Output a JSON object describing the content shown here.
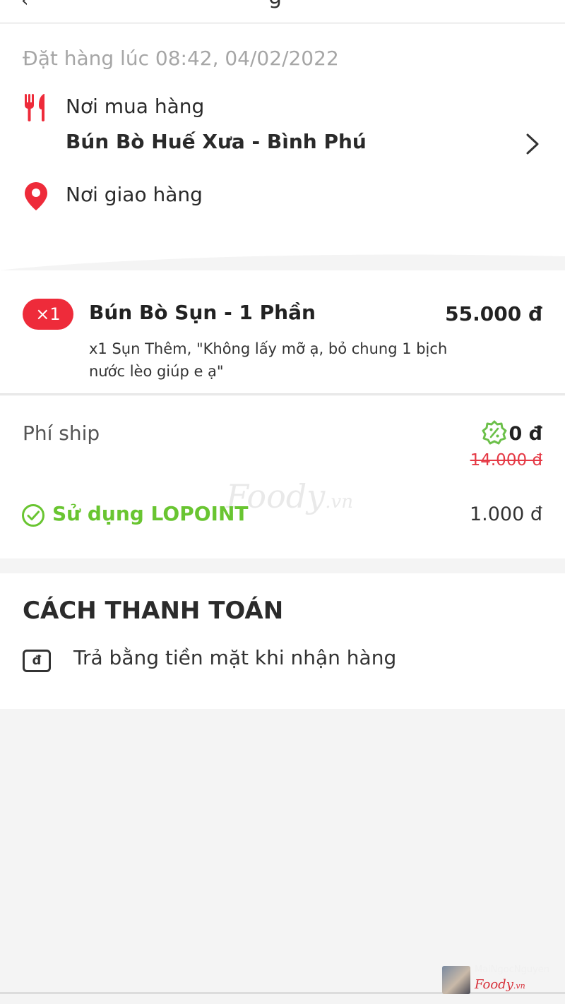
{
  "header": {
    "title_partial": "g"
  },
  "order": {
    "time_text": "Đặt hàng lúc 08:42, 04/02/2022",
    "purchase_place_label": "Nơi mua hàng",
    "restaurant_name": "Bún Bò Huế Xưa - Bình Phú",
    "delivery_place_label": "Nơi giao hàng"
  },
  "items": [
    {
      "qty": "×1",
      "name": "Bún Bò Sụn - 1 Phần",
      "price": "55.000 đ",
      "note": "x1 Sụn Thêm, \"Không lấy mỡ ạ, bỏ chung 1 bịch nước lèo giúp e ạ\""
    }
  ],
  "fees": {
    "ship_label": "Phí ship",
    "ship_value": "0 đ",
    "ship_original": "14.000 đ",
    "lopoint_label": "Sử dụng LOPOINT",
    "lopoint_value": "1.000 đ"
  },
  "payment": {
    "title": "CÁCH THANH TOÁN",
    "cash_symbol": "đ",
    "method": "Trả bằng tiền mặt khi nhận hàng"
  },
  "watermark": {
    "brand": "Foody",
    "suffix": ".vn"
  },
  "credit": {
    "user": "MaiNgocNguyen",
    "brand": "Foody",
    "suffix": ".vn"
  },
  "colors": {
    "accent_red": "#ee2b3a",
    "lopoint_green": "#69c531",
    "promo_green": "#6cc04a"
  },
  "icons": {
    "restaurant": "fork-knife-icon",
    "delivery": "map-pin-icon",
    "chevron": "chevron-right-icon",
    "promo": "discount-badge-icon",
    "lopoint": "check-circle-icon",
    "cash": "cash-icon"
  }
}
